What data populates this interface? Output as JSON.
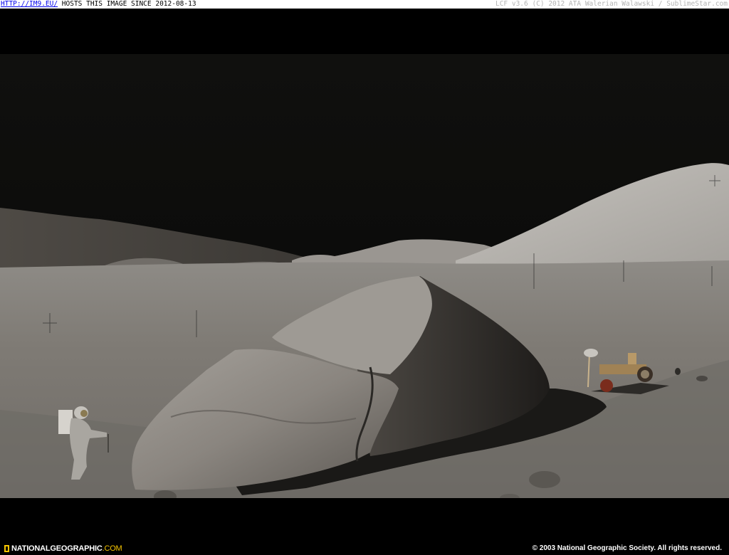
{
  "hosting_bar": {
    "link_text": "HTTP://IM9.EU/",
    "notice": " HOSTS THIS IMAGE SINCE 2012-08-13",
    "right_text": "LCF v3.6 (C) 2012 ATA Walerian Walawski / SublimeStar.com"
  },
  "credits": {
    "brand": "NATIONALGEOGRAPHIC",
    "brand_tld": ".COM",
    "copyright": "© 2003 National Geographic Society. All rights reserved."
  },
  "colors": {
    "logo_yellow": "#f5c400",
    "link_blue": "#0000ee",
    "sky": "#0b0b09",
    "regolith": "#8f8c87"
  }
}
